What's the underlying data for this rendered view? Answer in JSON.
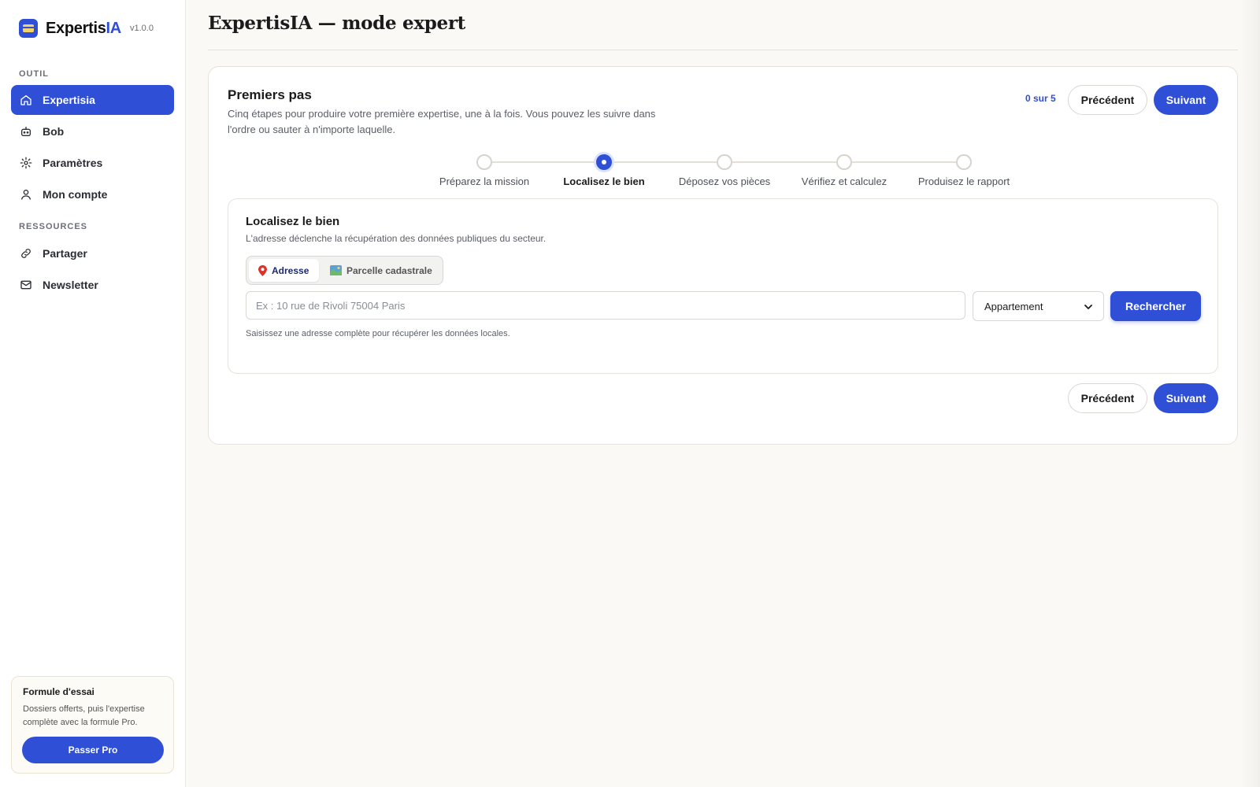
{
  "sidebar": {
    "brand": {
      "name_main": "Expertis",
      "name_accent": "IA",
      "version": "v1.0.0"
    },
    "sections": [
      {
        "label": "OUTIL"
      },
      {
        "label": "RESSOURCES"
      }
    ],
    "items": [
      {
        "label": "Expertisia",
        "icon": "home-icon",
        "active": true
      },
      {
        "label": "Bob",
        "icon": "robot-icon",
        "active": false
      },
      {
        "label": "Paramètres",
        "icon": "gear-icon",
        "active": false
      },
      {
        "label": "Mon compte",
        "icon": "user-icon",
        "active": false
      },
      {
        "label": "Partager",
        "icon": "link-icon",
        "active": false
      },
      {
        "label": "Newsletter",
        "icon": "mail-icon",
        "active": false
      }
    ],
    "trial": {
      "title": "Formule d'essai",
      "description": "Dossiers offerts, puis l'expertise complète avec la formule Pro.",
      "button": "Passer Pro"
    }
  },
  "header": {
    "title": "ExpertisIA — mode expert"
  },
  "onboarding": {
    "title": "Premiers pas",
    "description": "Cinq étapes pour produire votre première expertise, une à la fois. Vous pouvez les suivre dans l'ordre ou sauter à n'importe laquelle.",
    "progress": "0 sur 5",
    "prev_label": "Précédent",
    "next_label": "Suivant",
    "steps": [
      {
        "label": "Préparez la mission",
        "active": false
      },
      {
        "label": "Localisez le bien",
        "active": true
      },
      {
        "label": "Déposez vos pièces",
        "active": false
      },
      {
        "label": "Vérifiez et calculez",
        "active": false
      },
      {
        "label": "Produisez le rapport",
        "active": false
      }
    ]
  },
  "locate": {
    "title": "Localisez le bien",
    "description": "L'adresse déclenche la récupération des données publiques du secteur.",
    "tabs": [
      {
        "label": "Adresse",
        "icon": "pin-icon",
        "active": true
      },
      {
        "label": "Parcelle cadastrale",
        "icon": "map-icon",
        "active": false
      }
    ],
    "search_placeholder": "Ex : 10 rue de Rivoli 75004 Paris",
    "search_value": "",
    "property_type": "Appartement",
    "search_button": "Rechercher",
    "hint": "Saisissez une adresse complète pour récupérer les données locales."
  },
  "colors": {
    "accent": "#2f4fd6",
    "background": "#faf9f6"
  }
}
